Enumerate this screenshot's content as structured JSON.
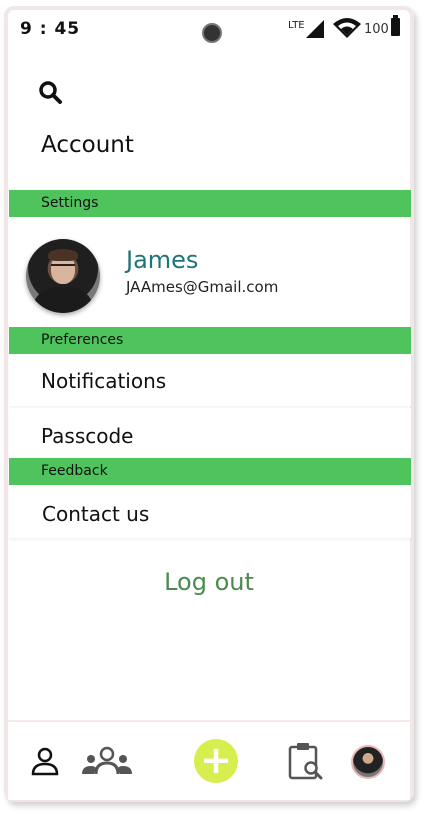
{
  "status_bar": {
    "time": "9 : 45",
    "network": "LTE",
    "battery": "100"
  },
  "header": {
    "title": "Account",
    "search_icon": "search-icon"
  },
  "sections": {
    "settings": "Settings",
    "preferences": "Preferences",
    "feedback": "Feedback"
  },
  "profile": {
    "name": "James",
    "email": "JAAmes@Gmail.com"
  },
  "menu": {
    "notifications": "Notifications",
    "passcode": "Passcode",
    "contact": "Contact us"
  },
  "logout_label": "Log out",
  "colors": {
    "section_green": "#4fc45c",
    "name_teal": "#1f7576",
    "logout_green": "#4b8a4e",
    "fab_yellow": "#d8ee4e"
  },
  "bottom_nav": {
    "icons": [
      "person-icon",
      "group-icon",
      "add-icon",
      "clipboard-search-icon",
      "avatar"
    ],
    "fab_label": "+"
  }
}
